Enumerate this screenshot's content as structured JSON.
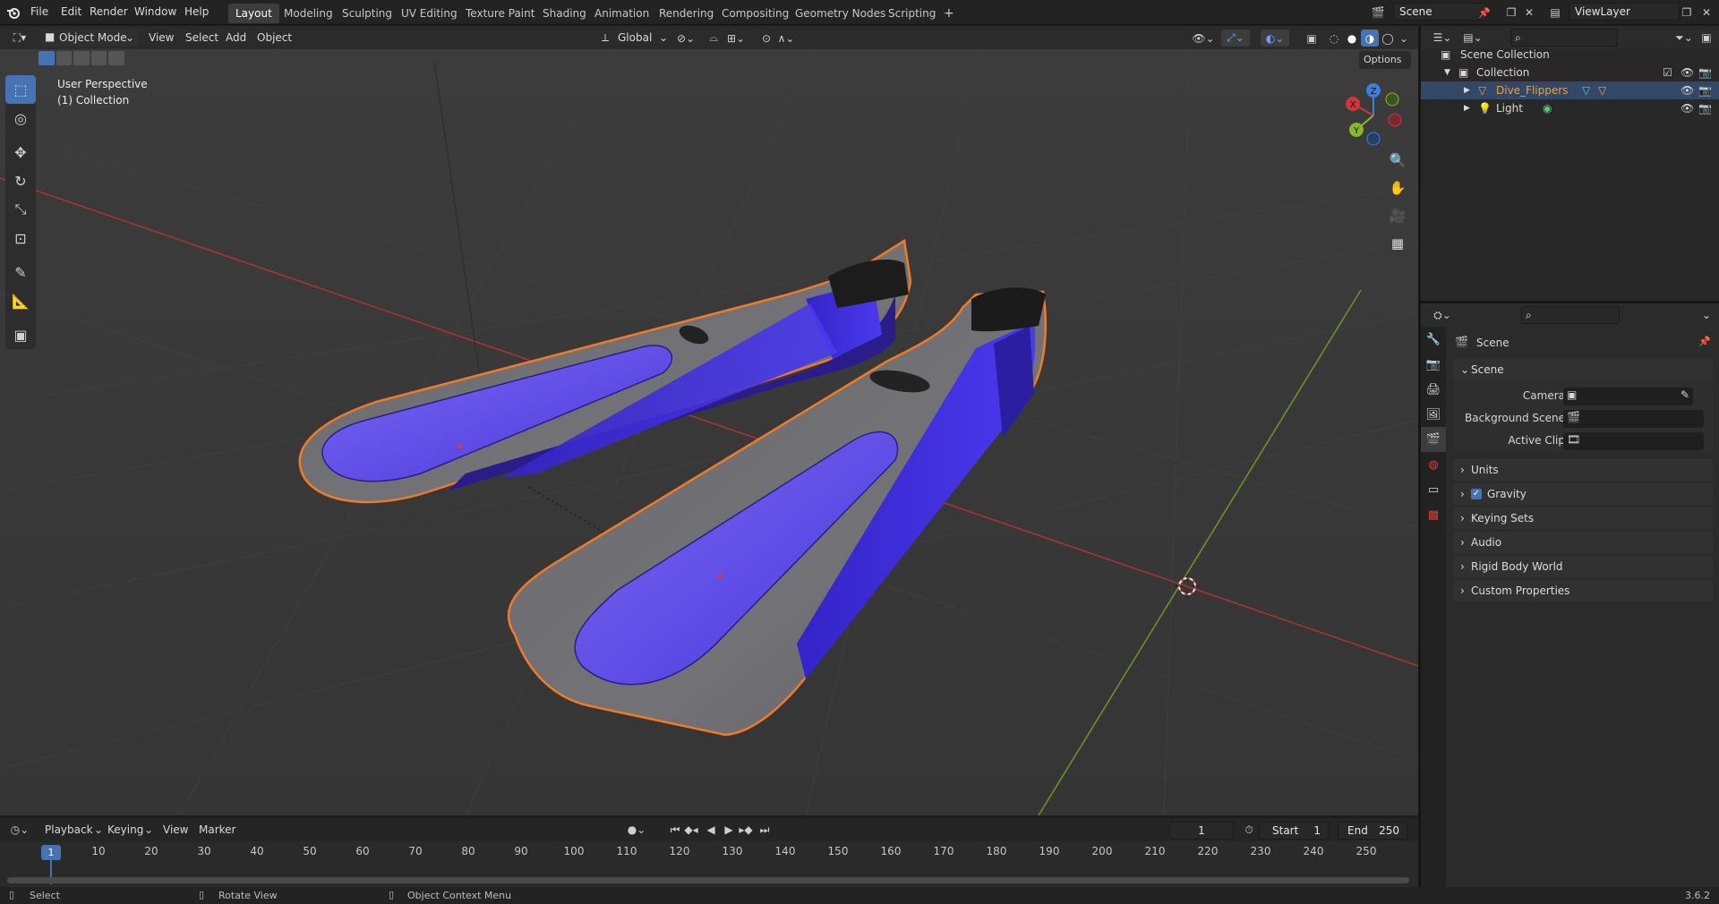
{
  "topbar": {
    "menus": [
      "File",
      "Edit",
      "Render",
      "Window",
      "Help"
    ],
    "workspaces": [
      "Layout",
      "Modeling",
      "Sculpting",
      "UV Editing",
      "Texture Paint",
      "Shading",
      "Animation",
      "Rendering",
      "Compositing",
      "Geometry Nodes",
      "Scripting"
    ],
    "active_workspace": "Layout",
    "add_tab": "+",
    "scene": "Scene",
    "view_layer": "ViewLayer"
  },
  "viewport": {
    "mode": "Object Mode",
    "menus": [
      "View",
      "Select",
      "Add",
      "Object"
    ],
    "orientation": "Global",
    "options": "Options",
    "info_line1": "User Perspective",
    "info_line2": "(1) Collection",
    "gizmo": {
      "x": "X",
      "y": "Y",
      "z": "Z"
    }
  },
  "timeline": {
    "menus": [
      "Playback",
      "Keying",
      "View",
      "Marker"
    ],
    "current_frame": "1",
    "start_label": "Start",
    "start": "1",
    "end_label": "End",
    "end": "250",
    "ticks": [
      "1",
      "10",
      "20",
      "30",
      "40",
      "50",
      "60",
      "70",
      "80",
      "90",
      "100",
      "110",
      "120",
      "130",
      "140",
      "150",
      "160",
      "170",
      "180",
      "190",
      "200",
      "210",
      "220",
      "230",
      "240",
      "250"
    ]
  },
  "status": {
    "select": "Select",
    "rotate": "Rotate View",
    "context": "Object Context Menu",
    "version": "3.6.2"
  },
  "outliner": {
    "scene_collection": "Scene Collection",
    "collection": "Collection",
    "items": [
      {
        "name": "Dive_Flippers",
        "color": "#e8a04a"
      },
      {
        "name": "Light",
        "color": "#d8d8d8"
      }
    ]
  },
  "properties": {
    "context_title": "Scene",
    "panel_scene": "Scene",
    "camera_label": "Camera",
    "bg_label": "Background Scene",
    "clip_label": "Active Clip",
    "panels": [
      "Units",
      "Gravity",
      "Keying Sets",
      "Audio",
      "Rigid Body World",
      "Custom Properties"
    ]
  },
  "colors": {
    "accent": "#4772b3",
    "selection_outline": "#f07a27",
    "flipper_blue": "#5a45e6",
    "x_axis": "#d0363b",
    "y_axis": "#85b82a"
  }
}
